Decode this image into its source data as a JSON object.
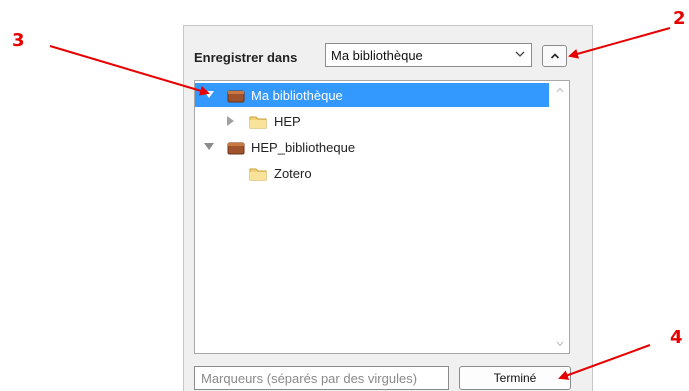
{
  "dialog": {
    "save_in_label": "Enregistrer dans",
    "location_select": {
      "value": "Ma bibliothèque"
    },
    "tags_input": {
      "placeholder": "Marqueurs (séparés par des virgules)",
      "value": ""
    },
    "done_button": "Terminé"
  },
  "tree": {
    "items": [
      {
        "label": "Ma bibliothèque",
        "level": 0,
        "expanded": true,
        "selected": true,
        "icon": "library-icon"
      },
      {
        "label": "HEP",
        "level": 1,
        "expanded": false,
        "selected": false,
        "icon": "folder-icon"
      },
      {
        "label": "HEP_bibliotheque",
        "level": 0,
        "expanded": true,
        "selected": false,
        "icon": "library-icon"
      },
      {
        "label": "Zotero",
        "level": 1,
        "expanded": false,
        "selected": false,
        "icon": "folder-icon"
      }
    ]
  },
  "annotations": {
    "callouts": [
      {
        "label": "2"
      },
      {
        "label": "3"
      },
      {
        "label": "4"
      }
    ],
    "color": "#e60000"
  },
  "colors": {
    "selection": "#3399ff",
    "panel_bg": "#f0f0f0"
  }
}
